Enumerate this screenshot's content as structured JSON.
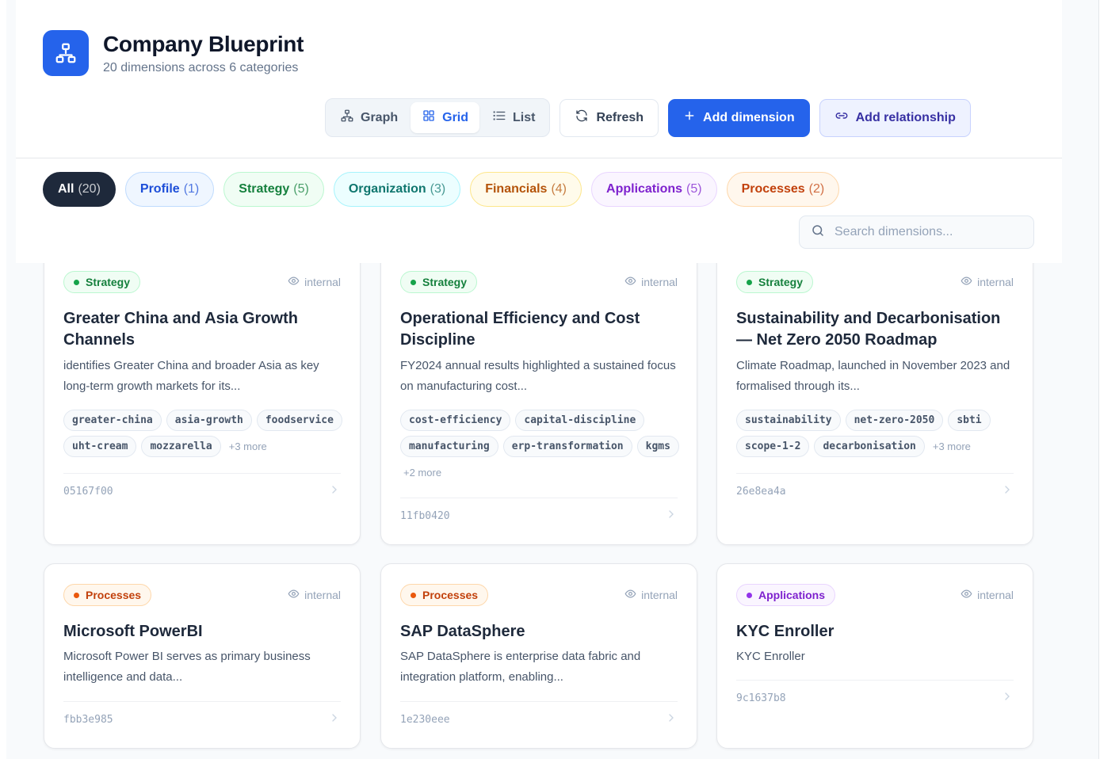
{
  "header": {
    "title": "Company Blueprint",
    "subtitle": "20 dimensions across 6 categories"
  },
  "view_switch": [
    {
      "label": "Graph",
      "icon": "graph-icon",
      "active": false
    },
    {
      "label": "Grid",
      "icon": "grid-icon",
      "active": true
    },
    {
      "label": "List",
      "icon": "list-icon",
      "active": false
    }
  ],
  "actions": {
    "refresh": "Refresh",
    "add_dimension": "Add dimension",
    "add_relationship": "Add relationship"
  },
  "filters": [
    {
      "label": "All",
      "count": "(20)",
      "bg": "#1e293b",
      "fg": "#ffffff",
      "border": "#1e293b"
    },
    {
      "label": "Profile",
      "count": "(1)",
      "bg": "#eff6ff",
      "fg": "#1d4ed8",
      "border": "#bfdbfe"
    },
    {
      "label": "Strategy",
      "count": "(5)",
      "bg": "#f0fdf4",
      "fg": "#15803d",
      "border": "#bbf7d0"
    },
    {
      "label": "Organization",
      "count": "(3)",
      "bg": "#ecfeff",
      "fg": "#0f766e",
      "border": "#a5f3fc"
    },
    {
      "label": "Financials",
      "count": "(4)",
      "bg": "#fffbeb",
      "fg": "#b45309",
      "border": "#fde68a"
    },
    {
      "label": "Applications",
      "count": "(5)",
      "bg": "#faf5ff",
      "fg": "#7e22ce",
      "border": "#e9d5ff"
    },
    {
      "label": "Processes",
      "count": "(2)",
      "bg": "#fff7ed",
      "fg": "#c2410c",
      "border": "#fed7aa"
    }
  ],
  "search": {
    "placeholder": "Search dimensions...",
    "value": ""
  },
  "category_styles": {
    "Strategy": {
      "bg": "#f0fdf4",
      "fg": "#15803d",
      "border": "#bbf7d0",
      "dot": "#16a34a"
    },
    "Processes": {
      "bg": "#fff7ed",
      "fg": "#c2410c",
      "border": "#fed7aa",
      "dot": "#ea580c"
    },
    "Applications": {
      "bg": "#faf5ff",
      "fg": "#7e22ce",
      "border": "#e9d5ff",
      "dot": "#9333ea"
    }
  },
  "cards": [
    {
      "category": "Strategy",
      "visibility": "internal",
      "title": "Greater China and Asia Growth Channels",
      "description": "identifies Greater China and broader Asia as key long-term growth markets for its...",
      "tags": [
        "greater-china",
        "asia-growth",
        "foodservice",
        "uht-cream",
        "mozzarella"
      ],
      "more": "+3 more",
      "id": "05167f00"
    },
    {
      "category": "Strategy",
      "visibility": "internal",
      "title": "Operational Efficiency and Cost Discipline",
      "description": "FY2024 annual results highlighted a sustained focus on manufacturing cost...",
      "tags": [
        "cost-efficiency",
        "capital-discipline",
        "manufacturing",
        "erp-transformation",
        "kgms"
      ],
      "more": "+2 more",
      "id": "11fb0420"
    },
    {
      "category": "Strategy",
      "visibility": "internal",
      "title": "Sustainability and Decarbonisation — Net Zero 2050 Roadmap",
      "description": "Climate Roadmap, launched in November 2023 and formalised through its...",
      "tags": [
        "sustainability",
        "net-zero-2050",
        "sbti",
        "scope-1-2",
        "decarbonisation"
      ],
      "more": "+3 more",
      "id": "26e8ea4a"
    },
    {
      "category": "Processes",
      "visibility": "internal",
      "title": "Microsoft PowerBI",
      "description": "Microsoft Power BI serves as primary business intelligence and data...",
      "tags": [],
      "more": "",
      "id": "fbb3e985"
    },
    {
      "category": "Processes",
      "visibility": "internal",
      "title": "SAP DataSphere",
      "description": "SAP DataSphere is enterprise data fabric and integration platform, enabling...",
      "tags": [],
      "more": "",
      "id": "1e230eee"
    },
    {
      "category": "Applications",
      "visibility": "internal",
      "title": "KYC Enroller",
      "description": "KYC Enroller",
      "tags": [],
      "more": "",
      "id": "9c1637b8"
    }
  ]
}
